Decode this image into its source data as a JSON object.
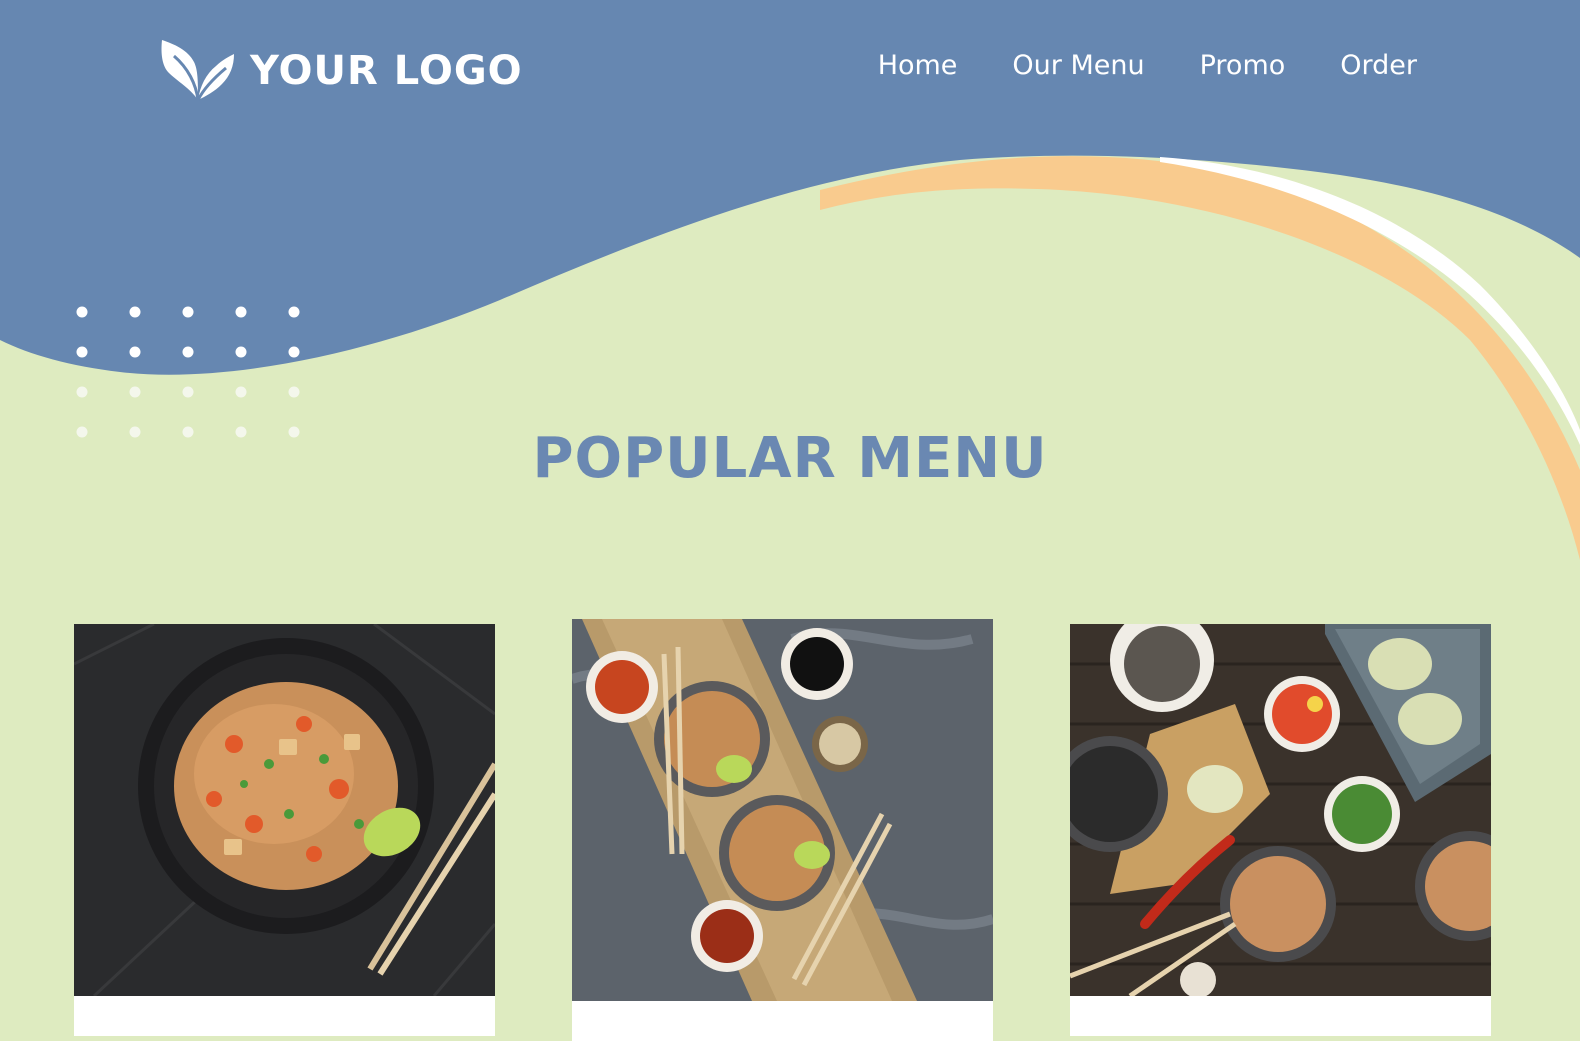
{
  "brand": {
    "logo_text": "YOUR LOGO",
    "logo_icon": "leaf-icon"
  },
  "nav": {
    "items": [
      {
        "label": "Home"
      },
      {
        "label": "Our Menu"
      },
      {
        "label": "Promo"
      },
      {
        "label": "Order"
      }
    ]
  },
  "section": {
    "title": "POPULAR MENU"
  },
  "colors": {
    "header_blue": "#6687b1",
    "background_green": "#deebc0",
    "accent_peach": "#f9cb8e",
    "title_blue": "#6a88b2",
    "white": "#ffffff"
  },
  "menu_cards": [
    {
      "image": "stir-fried-noodles-plate-photo"
    },
    {
      "image": "noodle-bowls-with-sauces-photo"
    },
    {
      "image": "asian-dishes-spread-photo"
    }
  ]
}
